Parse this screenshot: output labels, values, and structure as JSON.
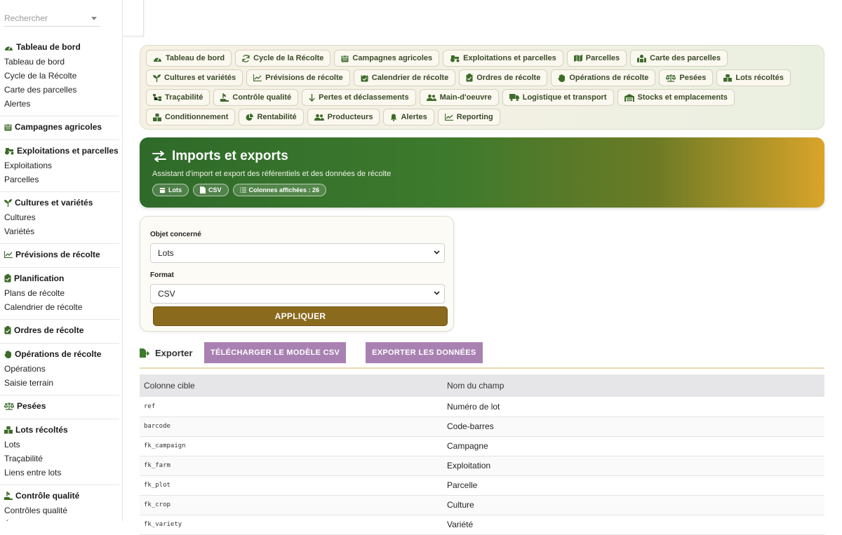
{
  "search": {
    "placeholder": "Rechercher"
  },
  "sidebar": {
    "sections": [
      {
        "title": "Tableau de bord",
        "icon": "gauge-icon",
        "items": [
          "Tableau de bord",
          "Cycle de la Récolte",
          "Carte des parcelles",
          "Alertes"
        ]
      },
      {
        "title": "Campagnes agricoles",
        "icon": "calendar-icon",
        "items": []
      },
      {
        "title": "Exploitations et parcelles",
        "icon": "tractor-icon",
        "items": [
          "Exploitations",
          "Parcelles"
        ]
      },
      {
        "title": "Cultures et variétés",
        "icon": "seedling-icon",
        "items": [
          "Cultures",
          "Variétés"
        ]
      },
      {
        "title": "Prévisions de récolte",
        "icon": "chart-line-icon",
        "items": []
      },
      {
        "title": "Planification",
        "icon": "clipboard-check-icon",
        "items": [
          "Plans de récolte",
          "Calendrier de récolte"
        ]
      },
      {
        "title": "Ordres de récolte",
        "icon": "clipboard-check-icon",
        "items": []
      },
      {
        "title": "Opérations de récolte",
        "icon": "hand-icon",
        "items": [
          "Opérations",
          "Saisie terrain"
        ]
      },
      {
        "title": "Pesées",
        "icon": "scale-icon",
        "items": []
      },
      {
        "title": "Lots récoltés",
        "icon": "boxes-icon",
        "items": [
          "Lots",
          "Traçabilité",
          "Liens entre lots"
        ]
      },
      {
        "title": "Contrôle qualité",
        "icon": "hand-holding-icon",
        "items": [
          "Contrôles qualité",
          "Échantillons qualité"
        ]
      }
    ]
  },
  "nav": {
    "pills": [
      {
        "label": "Tableau de bord",
        "icon": "gauge-icon"
      },
      {
        "label": "Cycle de la Récolte",
        "icon": "sync-icon"
      },
      {
        "label": "Campagnes agricoles",
        "icon": "calendar-icon"
      },
      {
        "label": "Exploitations et parcelles",
        "icon": "tractor-icon"
      },
      {
        "label": "Parcelles",
        "icon": "map-icon"
      },
      {
        "label": "Carte des parcelles",
        "icon": "map-marked-icon"
      },
      {
        "label": "Cultures et variétés",
        "icon": "seedling-icon"
      },
      {
        "label": "Prévisions de récolte",
        "icon": "chart-line-icon"
      },
      {
        "label": "Calendrier de récolte",
        "icon": "calendar-check-icon"
      },
      {
        "label": "Ordres de récolte",
        "icon": "clipboard-check-icon"
      },
      {
        "label": "Opérations de récolte",
        "icon": "hand-icon"
      },
      {
        "label": "Pesées",
        "icon": "scale-icon"
      },
      {
        "label": "Lots récoltés",
        "icon": "boxes-icon"
      },
      {
        "label": "Traçabilité",
        "icon": "sitemap-icon"
      },
      {
        "label": "Contrôle qualité",
        "icon": "hand-holding-icon"
      },
      {
        "label": "Pertes et déclassements",
        "icon": "arrow-down-icon"
      },
      {
        "label": "Main-d'oeuvre",
        "icon": "users-icon"
      },
      {
        "label": "Logistique et transport",
        "icon": "truck-icon"
      },
      {
        "label": "Stocks et emplacements",
        "icon": "warehouse-icon"
      },
      {
        "label": "Conditionnement",
        "icon": "cubes-icon"
      },
      {
        "label": "Rentabilité",
        "icon": "pie-chart-icon"
      },
      {
        "label": "Producteurs",
        "icon": "users-icon"
      },
      {
        "label": "Alertes",
        "icon": "bell-icon"
      },
      {
        "label": "Reporting",
        "icon": "chart-line-icon"
      }
    ]
  },
  "hero": {
    "title": "Imports et exports",
    "subtitle": "Assistant d'import et export des référentiels et des données de récolte",
    "badges": [
      "Lots",
      "CSV",
      "Colonnes affichées : 26"
    ]
  },
  "form": {
    "object_label": "Objet concerné",
    "object_value": "Lots",
    "format_label": "Format",
    "format_value": "CSV",
    "apply_label": "APPLIQUER"
  },
  "export": {
    "label": "Exporter",
    "template_button": "TÉLÉCHARGER LE MODÈLE CSV",
    "export_button": "EXPORTER LES DONNÉES"
  },
  "table": {
    "headers": [
      "Colonne cible",
      "Nom du champ"
    ],
    "rows": [
      [
        "ref",
        "Numéro de lot"
      ],
      [
        "barcode",
        "Code-barres"
      ],
      [
        "fk_campaign",
        "Campagne"
      ],
      [
        "fk_farm",
        "Exploitation"
      ],
      [
        "fk_plot",
        "Parcelle"
      ],
      [
        "fk_crop",
        "Culture"
      ],
      [
        "fk_variety",
        "Variété"
      ]
    ]
  },
  "colors": {
    "accent_green": "#3d7a2d",
    "accent_gold": "#d9a42a",
    "apply_brown": "#8a6a1d",
    "export_purple": "#a881b2"
  }
}
